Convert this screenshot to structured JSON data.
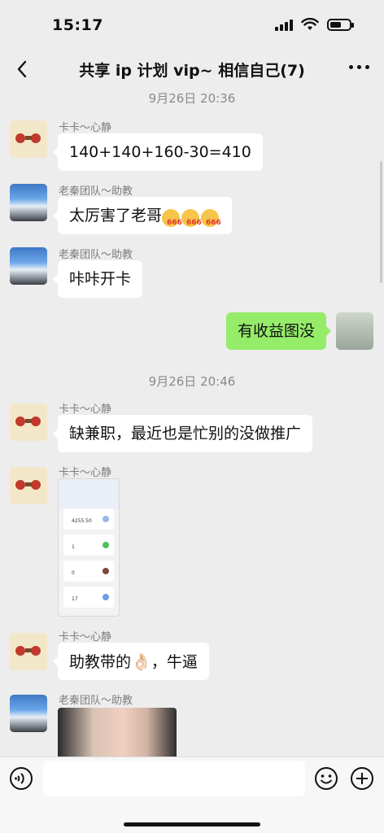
{
  "status_bar": {
    "time": "15:17"
  },
  "nav": {
    "title": "共享 ip 计划 vip~ 相信自己(7)"
  },
  "timestamps": [
    "9月26日 20:36",
    "9月26日 20:46"
  ],
  "messages": [
    {
      "sender": "卡卡～心静",
      "text": "140+140+160-30=410"
    },
    {
      "sender": "老秦团队～助教",
      "text": "太厉害了老哥",
      "emoji_count": 3,
      "emoji_tag": "666"
    },
    {
      "sender": "老秦团队～助教",
      "text": "咔咔开卡"
    },
    {
      "self": true,
      "text": "有收益图没"
    },
    {
      "sender": "卡卡～心静",
      "text": "缺兼职，最近也是忙别的没做推广"
    },
    {
      "sender": "卡卡～心静",
      "image": "screenshot",
      "thumb_values": [
        "4255.50",
        "1",
        "0",
        "17"
      ]
    },
    {
      "sender": "卡卡～心静",
      "text_before": "助教带的",
      "emoji": "👌🏻",
      "text_after": "，牛逼"
    },
    {
      "sender": "老秦团队～助教",
      "image": "photo"
    }
  ],
  "input": {
    "placeholder": ""
  },
  "icons": [
    "back-icon",
    "more-icon",
    "voice-icon",
    "emoji-icon",
    "plus-icon"
  ]
}
